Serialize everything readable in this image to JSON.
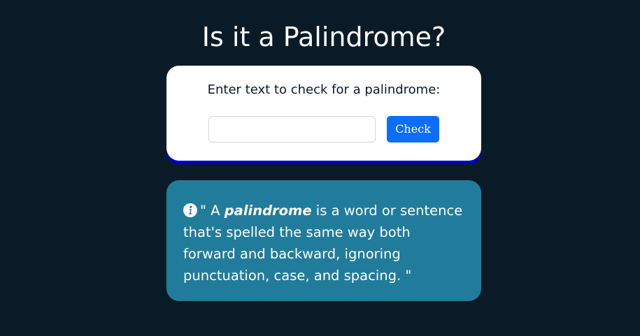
{
  "page": {
    "title": "Is it a Palindrome?"
  },
  "checker": {
    "label": "Enter text to check for a palindrome:",
    "input_value": "",
    "input_placeholder": "",
    "button_label": "Check",
    "button_color": "#0d6efd"
  },
  "info": {
    "icon": "info-icon",
    "quote_open": "\" A ",
    "term": "palindrome",
    "definition": " is a word or sentence that's spelled the same way both forward and backward, ignoring punctuation, case, and spacing. \"",
    "background_color": "#217c9c"
  },
  "colors": {
    "page_background": "#0a1b27",
    "card_background": "#ffffff",
    "card_shadow": "#0000cc"
  }
}
